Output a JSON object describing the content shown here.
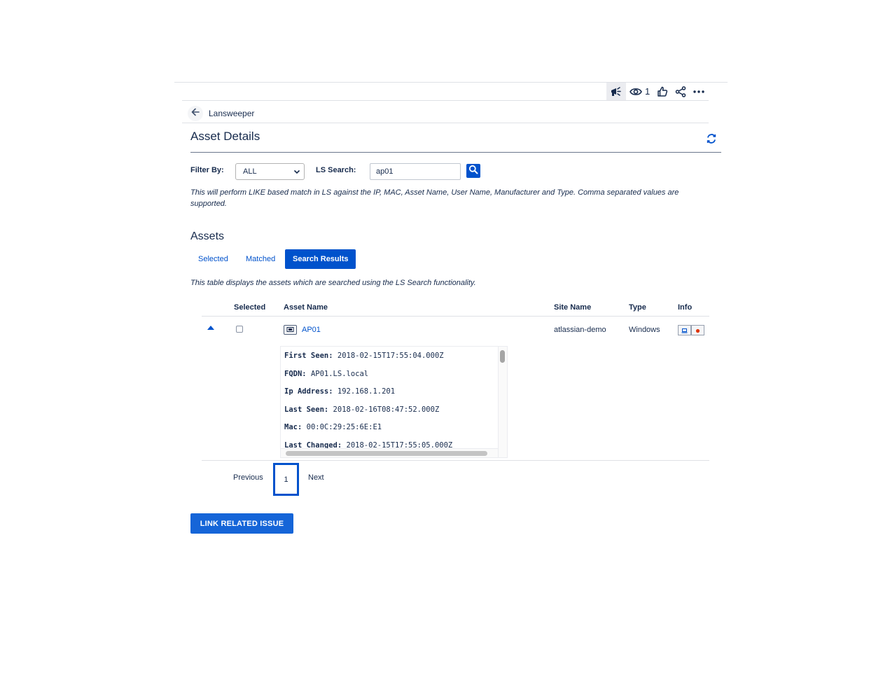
{
  "toolbar": {
    "watch_count": "1"
  },
  "breadcrumb": {
    "label": "Lansweeper"
  },
  "page": {
    "title": "Asset Details"
  },
  "filters": {
    "filter_by_label": "Filter By:",
    "filter_by_value": "ALL",
    "ls_search_label": "LS Search:",
    "ls_search_value": "ap01",
    "hint": "This will perform LIKE based match in LS against the IP, MAC, Asset Name, User Name, Manufacturer and Type. Comma separated values are supported."
  },
  "assets": {
    "heading": "Assets",
    "tabs": [
      {
        "label": "Selected",
        "active": false
      },
      {
        "label": "Matched",
        "active": false
      },
      {
        "label": "Search Results",
        "active": true
      }
    ],
    "description": "This table displays the assets which are searched using the LS Search functionality.",
    "columns": [
      "Selected",
      "Asset Name",
      "Site Name",
      "Type",
      "Info"
    ],
    "rows": [
      {
        "asset_name": "AP01",
        "site_name": "atlassian-demo",
        "type": "Windows",
        "details": [
          {
            "key": "First Seen:",
            "value": "2018-02-15T17:55:04.000Z"
          },
          {
            "key": "FQDN:",
            "value": "AP01.LS.local"
          },
          {
            "key": "Ip Address:",
            "value": "192.168.1.201"
          },
          {
            "key": "Last Seen:",
            "value": "2018-02-16T08:47:52.000Z"
          },
          {
            "key": "Mac:",
            "value": "00:0C:29:25:6E:E1"
          },
          {
            "key": "Last Changed:",
            "value": "2018-02-15T17:55:05.000Z"
          }
        ]
      }
    ]
  },
  "pagination": {
    "previous": "Previous",
    "current": "1",
    "next": "Next"
  },
  "actions": {
    "link_related_issue": "LINK RELATED ISSUE"
  },
  "colors": {
    "primary": "#0052cc",
    "text": "#172b4d",
    "button": "#1565d8"
  }
}
